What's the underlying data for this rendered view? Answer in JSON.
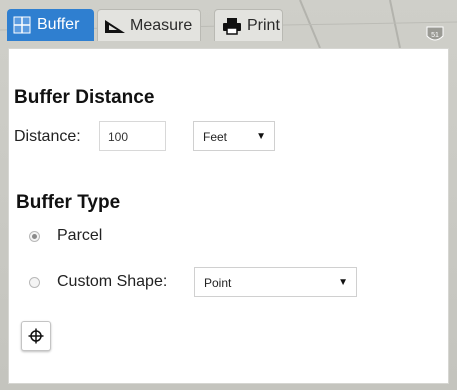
{
  "tabs": {
    "buffer": {
      "label": "Buffer",
      "icon": "grid-icon"
    },
    "measure": {
      "label": "Measure",
      "icon": "ruler-icon"
    },
    "print": {
      "label": "Print",
      "icon": "printer-icon"
    }
  },
  "map": {
    "route_shield": "51"
  },
  "buffer_distance": {
    "title": "Buffer Distance",
    "distance_label": "Distance:",
    "distance_value": "100",
    "units_selected": "Feet"
  },
  "buffer_type": {
    "title": "Buffer Type",
    "option_parcel": "Parcel",
    "option_custom": "Custom Shape:",
    "selected_option": "Parcel",
    "shape_selected": "Point"
  },
  "colors": {
    "active_tab": "#2f7fd0",
    "inactive_tab": "#e3e3df",
    "panel_bg": "#ffffff",
    "map_bg": "#c8c8c3"
  }
}
